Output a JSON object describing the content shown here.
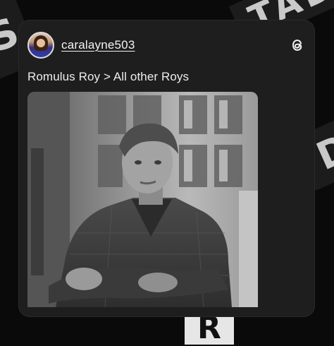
{
  "post": {
    "username": "caralayne503",
    "caption": "Romulus Roy > All other Roys",
    "brand_icon": "threads-logo-icon"
  },
  "background_lettering": [
    "S",
    "TAD",
    "D",
    "R"
  ],
  "colors": {
    "background": "#0a0a0a",
    "card": "#1e1e1e",
    "text": "#f4f4f4"
  }
}
